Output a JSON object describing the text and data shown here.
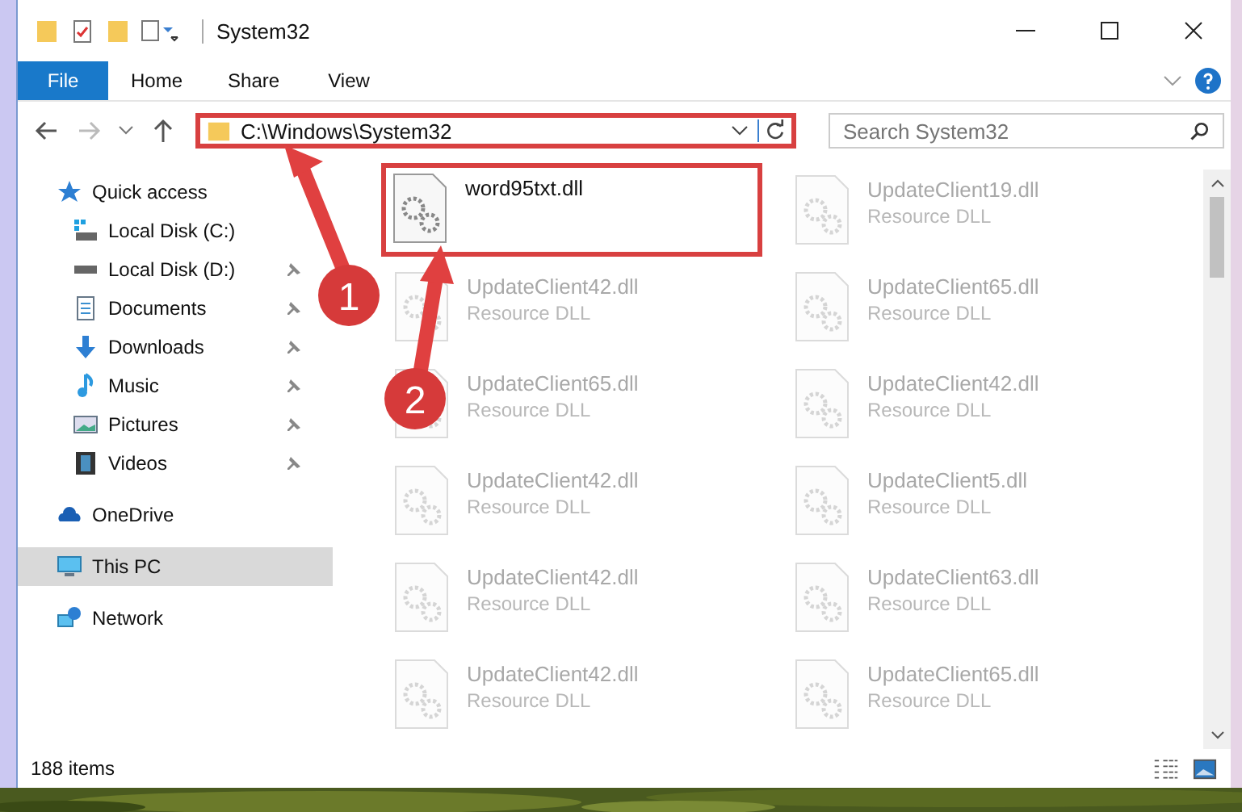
{
  "window": {
    "title": "System32"
  },
  "ribbon_tabs": [
    {
      "label": "File",
      "selected": true
    },
    {
      "label": "Home",
      "selected": false
    },
    {
      "label": "Share",
      "selected": false
    },
    {
      "label": "View",
      "selected": false
    }
  ],
  "address": {
    "path": "C:\\Windows\\System32",
    "highlighted": true
  },
  "search": {
    "placeholder": "Search System32"
  },
  "sidebar": {
    "items": [
      {
        "label": "Quick access",
        "kind": "star",
        "selected": false,
        "pinned": false,
        "children": [
          {
            "label": "Local Disk (C:)",
            "kind": "windisk",
            "selected": false,
            "pinned": false
          },
          {
            "label": "Local Disk (D:)",
            "kind": "disk",
            "selected": false,
            "pinned": true
          },
          {
            "label": "Documents",
            "kind": "docs",
            "selected": false,
            "pinned": true
          },
          {
            "label": "Downloads",
            "kind": "download",
            "selected": false,
            "pinned": true
          },
          {
            "label": "Music",
            "kind": "music",
            "selected": false,
            "pinned": true
          },
          {
            "label": "Pictures",
            "kind": "pictures",
            "selected": false,
            "pinned": true
          },
          {
            "label": "Videos",
            "kind": "videos",
            "selected": false,
            "pinned": true
          }
        ]
      },
      {
        "label": "OneDrive",
        "kind": "cloud",
        "selected": false,
        "pinned": false
      },
      {
        "label": "This PC",
        "kind": "pc",
        "selected": true,
        "pinned": false
      },
      {
        "label": "Network",
        "kind": "network",
        "selected": false,
        "pinned": false
      }
    ]
  },
  "files": [
    {
      "name": "word95txt.dll",
      "highlighted": true,
      "blurred": false
    },
    {
      "name": "UpdateClient19.dll",
      "type": "Resource DLL",
      "highlighted": false,
      "blurred": true
    },
    {
      "name": "UpdateClient42.dll",
      "type": "Resource DLL",
      "highlighted": false,
      "blurred": true
    },
    {
      "name": "UpdateClient65.dll",
      "type": "Resource DLL",
      "highlighted": false,
      "blurred": true
    },
    {
      "name": "UpdateClient65.dll",
      "type": "Resource DLL",
      "highlighted": false,
      "blurred": true
    },
    {
      "name": "UpdateClient42.dll",
      "type": "Resource DLL",
      "highlighted": false,
      "blurred": true
    },
    {
      "name": "UpdateClient42.dll",
      "type": "Resource DLL",
      "highlighted": false,
      "blurred": true
    },
    {
      "name": "UpdateClient5.dll",
      "type": "Resource DLL",
      "highlighted": false,
      "blurred": true
    },
    {
      "name": "UpdateClient42.dll",
      "type": "Resource DLL",
      "highlighted": false,
      "blurred": true
    },
    {
      "name": "UpdateClient63.dll",
      "type": "Resource DLL",
      "highlighted": false,
      "blurred": true
    },
    {
      "name": "UpdateClient42.dll",
      "type": "Resource DLL",
      "highlighted": false,
      "blurred": true
    },
    {
      "name": "UpdateClient65.dll",
      "type": "Resource DLL",
      "highlighted": false,
      "blurred": true
    }
  ],
  "status_bar": {
    "item_count": "188 items"
  },
  "annotations": [
    {
      "label": "1"
    },
    {
      "label": "2"
    }
  ]
}
